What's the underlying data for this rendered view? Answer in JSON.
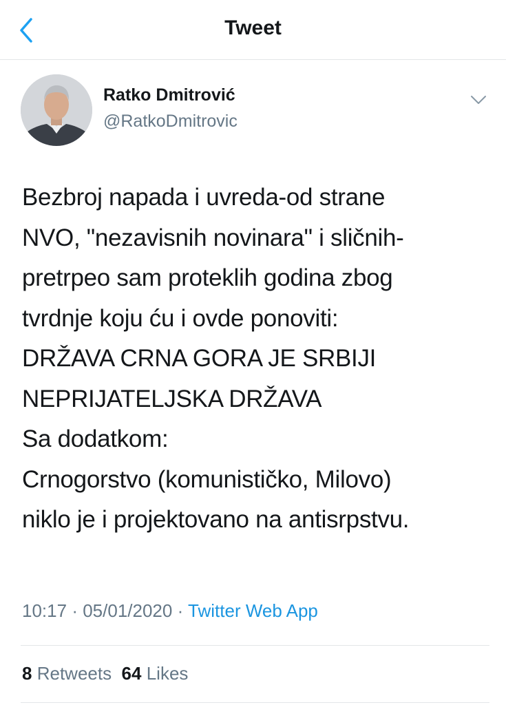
{
  "header": {
    "title": "Tweet",
    "back_icon": "chevron-left-icon"
  },
  "author": {
    "name": "Ratko Dmitrović",
    "handle": "@RatkoDmitrovic",
    "avatar": "avatar-photo"
  },
  "tweet": {
    "lines": [
      "Bezbroj napada i uvreda-od strane",
      "NVO, \"nezavisnih novinara\" i sličnih-",
      "pretrpeo sam proteklih godina zbog",
      "tvrdnje koju ću i ovde ponoviti:",
      "DRŽAVA CRNA GORA JE SRBIJI",
      "NEPRIJATELJSKA DRŽAVA",
      "Sa dodatkom:",
      "Crnogorstvo (komunističko, Milovo)",
      "niklo je i projektovano na antisrpstvu."
    ],
    "time": "10:17",
    "date": "05/01/2020",
    "separator": "·",
    "source": "Twitter Web App"
  },
  "stats": {
    "retweets_count": "8",
    "retweets_label": "Retweets",
    "likes_count": "64",
    "likes_label": "Likes"
  },
  "colors": {
    "accent": "#1da1f2",
    "link": "#1b95e0",
    "muted": "#657786",
    "text": "#14171a"
  }
}
